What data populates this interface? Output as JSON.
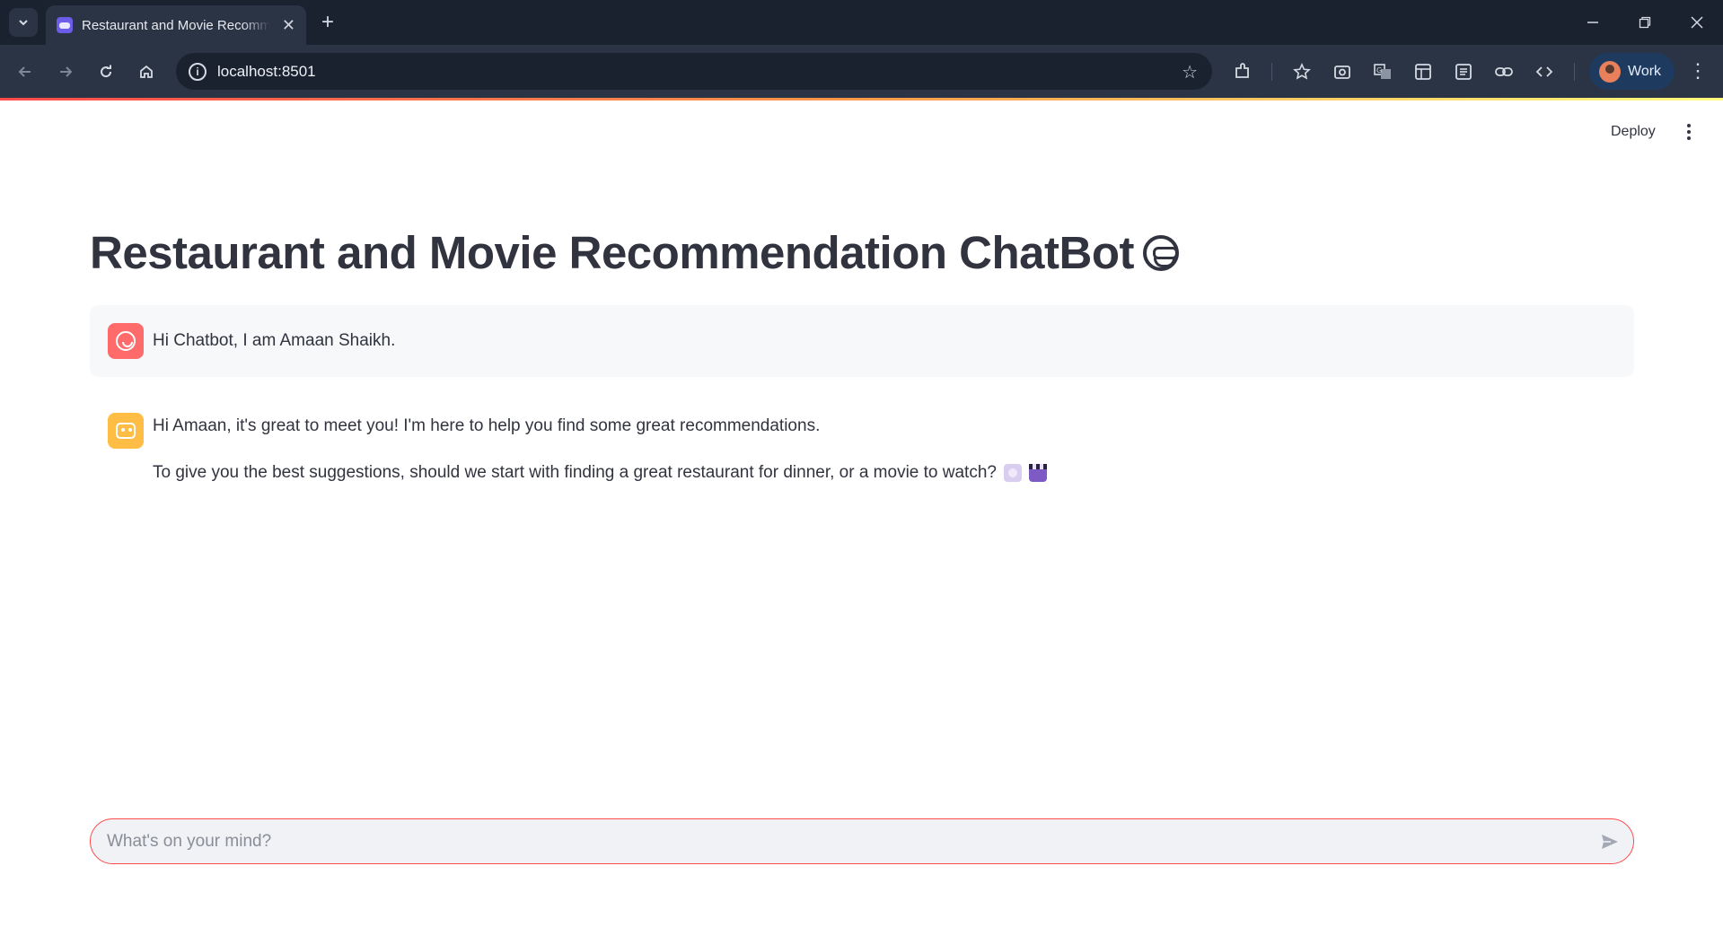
{
  "browser": {
    "tab_title": "Restaurant and Movie Recommendation ChatBot",
    "url": "localhost:8501",
    "profile_name": "Work"
  },
  "app": {
    "deploy_label": "Deploy",
    "title": "Restaurant and Movie Recommendation ChatBot"
  },
  "chat": {
    "messages": [
      {
        "role": "user",
        "text": "Hi Chatbot, I am Amaan Shaikh."
      },
      {
        "role": "assistant",
        "line1": "Hi Amaan, it's great to meet you! I'm here to help you find some great recommendations.",
        "line2": "To give you the best suggestions, should we start with finding a great restaurant for dinner, or a movie to watch?"
      }
    ],
    "input_placeholder": "What's on your mind?"
  },
  "colors": {
    "accent": "#ff4b4b",
    "user_avatar": "#ff6b6b",
    "bot_avatar": "#ffbd45",
    "chrome_dark": "#1a2230"
  }
}
